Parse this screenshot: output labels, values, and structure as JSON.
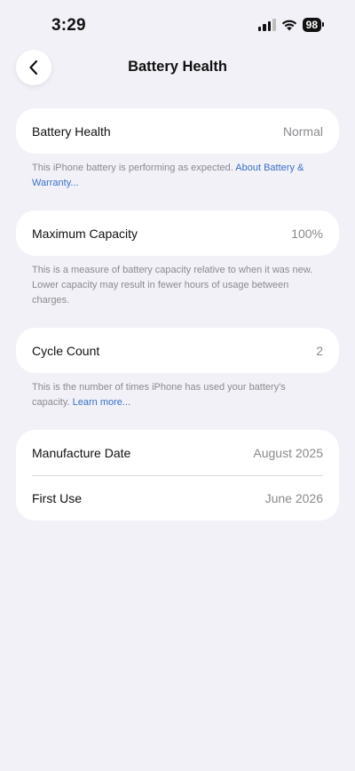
{
  "status_bar": {
    "time": "3:29",
    "battery_level": "98"
  },
  "nav": {
    "title": "Battery Health",
    "back_icon": "chevron-left-icon"
  },
  "battery_health": {
    "label": "Battery Health",
    "value": "Normal",
    "footnote": "This iPhone battery is performing as expected.",
    "link": "About Battery & Warranty..."
  },
  "maximum_capacity": {
    "label": "Maximum Capacity",
    "value": "100%",
    "footnote": "This is a measure of battery capacity relative to when it was new. Lower capacity may result in fewer hours of usage between charges."
  },
  "cycle_count": {
    "label": "Cycle Count",
    "value": "2",
    "footnote": "This is the number of times iPhone has used your battery's capacity.",
    "link": "Learn more..."
  },
  "dates": {
    "manufacture_label": "Manufacture Date",
    "manufacture_value": "August 2025",
    "first_use_label": "First Use",
    "first_use_value": "June 2026"
  },
  "colors": {
    "background": "#f2f1f7",
    "link": "#3a70c8",
    "secondary_text": "#8a8a8e"
  }
}
